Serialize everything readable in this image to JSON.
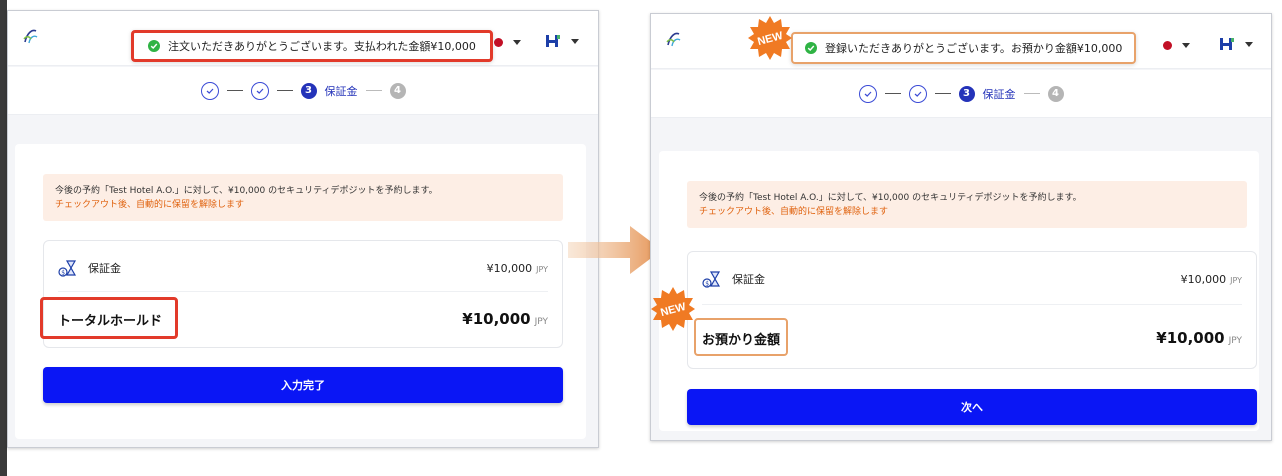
{
  "left": {
    "toast": "注文いただきありがとうございます。支払われた金額¥10,000",
    "step_label": "保証金",
    "step_current": "3",
    "step_next": "4",
    "notice_line1": "今後の予約「Test Hotel A.O.」に対して、¥10,000 のセキュリティデポジットを予約します。",
    "notice_line2": "チェックアウト後、自動的に保留を解除します",
    "item_label": "保証金",
    "item_amount": "¥10,000",
    "item_currency": "JPY",
    "total_label": "トータルホールド",
    "total_amount": "¥10,000",
    "total_currency": "JPY",
    "button_label": "入力完了"
  },
  "right": {
    "badge_text": "NEW",
    "toast": "登録いただきありがとうございます。お預かり金額¥10,000",
    "step_label": "保証金",
    "step_current": "3",
    "step_next": "4",
    "notice_line1": "今後の予約「Test Hotel A.O.」に対して、¥10,000 のセキュリティデポジットを予約します。",
    "notice_line2": "チェックアウト後、自動的に保留を解除します",
    "item_label": "保証金",
    "item_amount": "¥10,000",
    "item_currency": "JPY",
    "total_label": "お預かり金額",
    "total_amount": "¥10,000",
    "total_currency": "JPY",
    "button_label": "次へ"
  },
  "colors": {
    "primary_button": "#0a16f5",
    "highlight_red": "#e23a2a",
    "highlight_orange": "#e8a26a",
    "badge_orange": "#f07a23",
    "notice_bg": "#fdeee5",
    "notice_accent": "#e0620e",
    "success_green": "#2fb344"
  }
}
